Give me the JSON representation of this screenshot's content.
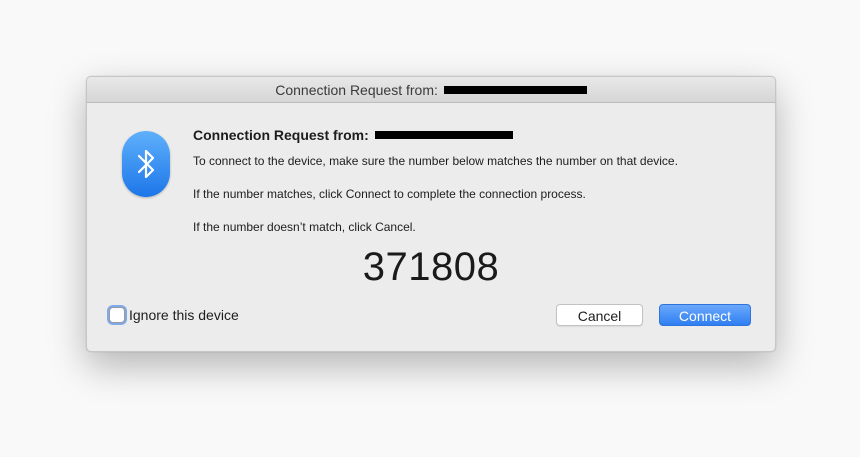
{
  "window": {
    "title": "Connection Request from:"
  },
  "message": {
    "heading": "Connection Request from:",
    "line1": "To connect to the device, make sure the number below matches the number on that device.",
    "line2": "If the number matches, click Connect to complete the connection process.",
    "line3": "If the number doesn’t match, click Cancel."
  },
  "pairing_code": "371808",
  "ignore_checkbox": {
    "label": "Ignore this device",
    "checked": false
  },
  "buttons": {
    "cancel": "Cancel",
    "connect": "Connect"
  },
  "icons": {
    "app": "bluetooth-icon"
  },
  "colors": {
    "accent": "#2f7ff2",
    "icon_blue": "#1c76e8"
  }
}
